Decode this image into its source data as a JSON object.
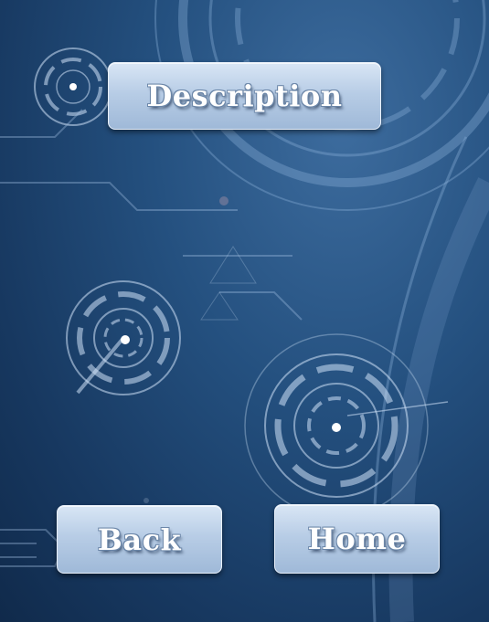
{
  "screen": {
    "background_theme": "blue tech circuit with concentric dials",
    "colors": {
      "background_dark": "#102a4b",
      "background_mid": "#24507f",
      "button_fill": "#b8cde6",
      "button_text": "#ffffff"
    }
  },
  "buttons": {
    "description_label": "Description",
    "back_label": "Back",
    "home_label": "Home"
  }
}
